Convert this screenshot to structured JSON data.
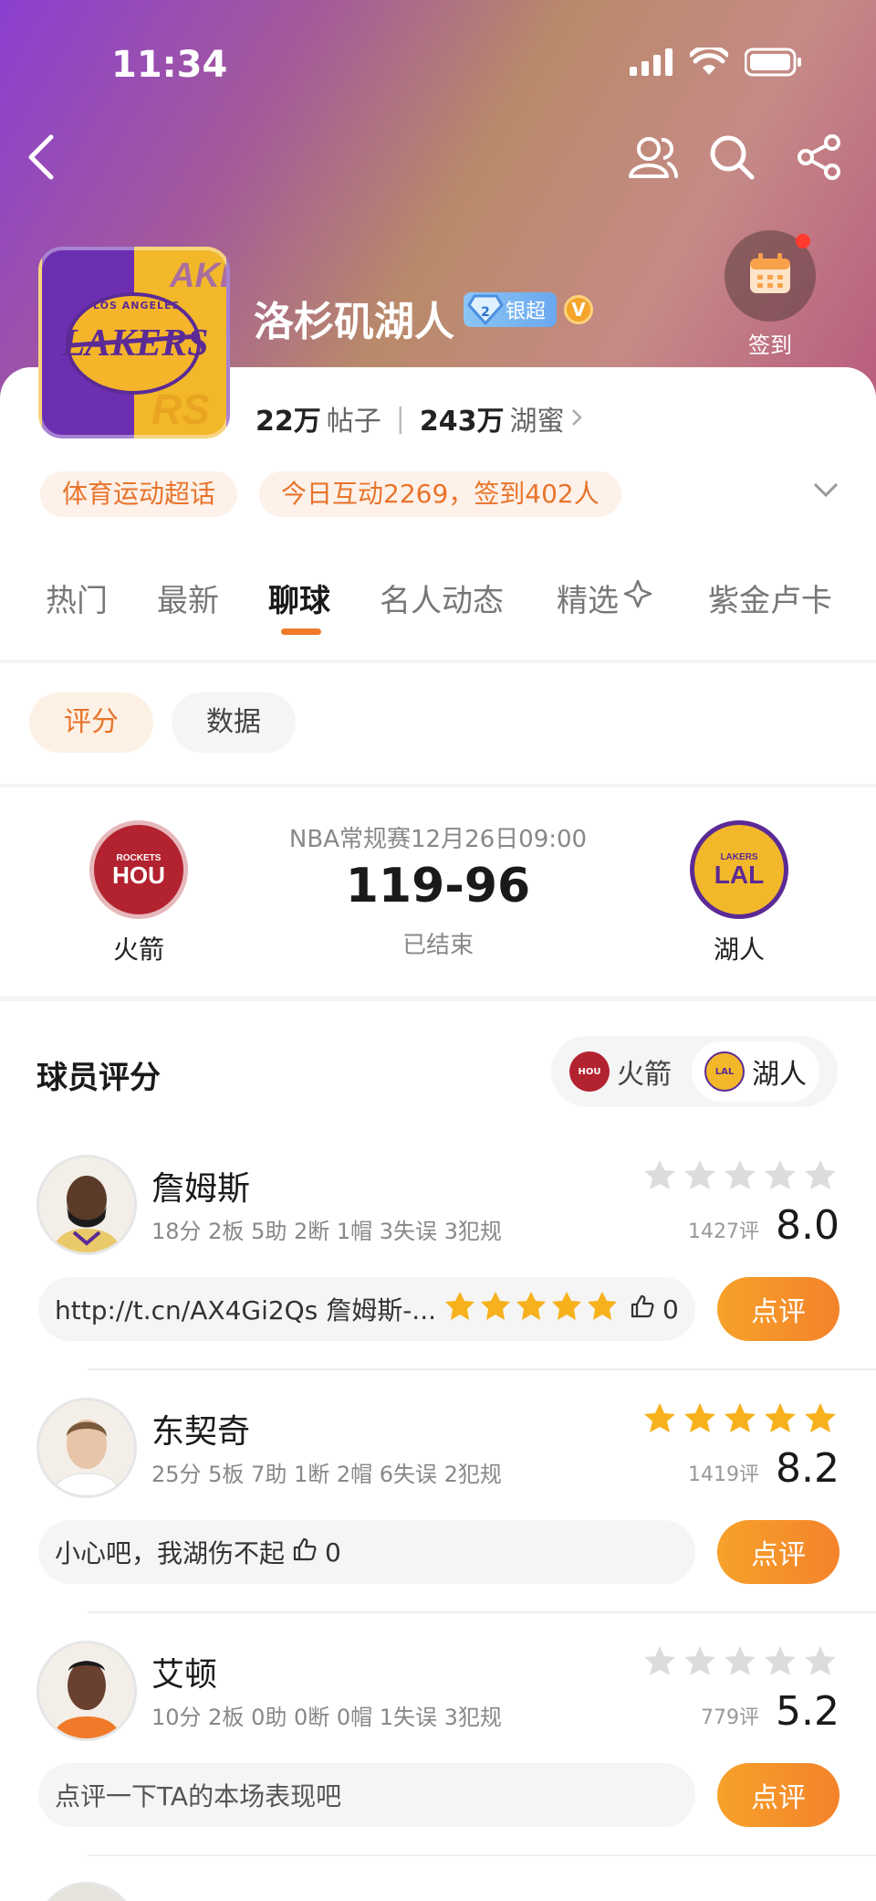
{
  "status_bar": {
    "time": "11:34"
  },
  "club": {
    "name": "洛杉矶湖人",
    "level_badge": "银超",
    "verified_mark": "V",
    "logo_text_top": "LOS ANGELES",
    "logo_text_main": "LAKERS"
  },
  "checkin": {
    "label": "签到"
  },
  "stats": {
    "posts_count": "22万",
    "posts_label": "帖子",
    "fans_count": "243万",
    "fans_label": "湖蜜"
  },
  "tags": [
    "体育运动超话",
    "今日互动2269，签到402人"
  ],
  "tabs": [
    {
      "label": "热门"
    },
    {
      "label": "最新"
    },
    {
      "label": "聊球"
    },
    {
      "label": "名人动态"
    },
    {
      "label": "精选"
    },
    {
      "label": "紫金卢卡"
    }
  ],
  "sub_tabs": [
    {
      "label": "评分"
    },
    {
      "label": "数据"
    }
  ],
  "match": {
    "league_time": "NBA常规赛12月26日09:00",
    "score": "119-96",
    "status": "已结束",
    "home": {
      "name": "火箭",
      "abbr": "HOU",
      "sub": "ROCKETS",
      "color": "#b3222f"
    },
    "away": {
      "name": "湖人",
      "abbr": "LAL",
      "sub": "LAKERS",
      "color": "#f2b82a"
    }
  },
  "ratings_section": {
    "title": "球员评分",
    "team_filter": [
      "火箭",
      "湖人"
    ]
  },
  "players": [
    {
      "name": "詹姆斯",
      "stats": "18分 2板 5助 2断 1帽 3失误 3犯规",
      "count": "1427评",
      "score": "8.0",
      "stars_filled": 0,
      "comment": "http://t.cn/AX4Gi2Qs 詹姆斯-...",
      "comment_stars": 5,
      "likes": "0",
      "button": "点评"
    },
    {
      "name": "东契奇",
      "stats": "25分 5板 7助 1断 2帽 6失误 2犯规",
      "count": "1419评",
      "score": "8.2",
      "stars_filled": 5,
      "comment": "小心吧，我湖伤不起",
      "comment_stars": 0,
      "likes": "0",
      "button": "点评"
    },
    {
      "name": "艾顿",
      "stats": "10分 2板 0助 0断 0帽 1失误 3犯规",
      "count": "779评",
      "score": "5.2",
      "stars_filled": 0,
      "comment": "点评一下TA的本场表现吧",
      "comment_stars": 0,
      "likes": null,
      "button": "点评"
    }
  ],
  "colors": {
    "accent": "#ee7a2a",
    "star_on": "#f6b11c",
    "star_off": "#dcdcdc"
  }
}
